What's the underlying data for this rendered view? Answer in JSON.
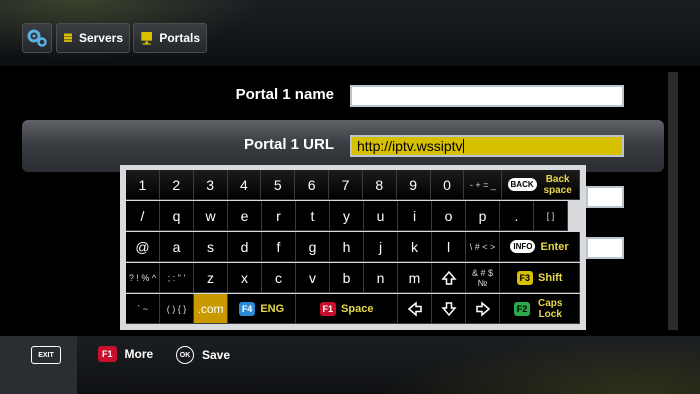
{
  "topbar": {
    "settings_icon": "gear-icon",
    "servers_label": "Servers",
    "portals_label": "Portals"
  },
  "form": {
    "portal_name_label": "Portal 1 name",
    "portal_name_value": "",
    "portal_url_label": "Portal 1 URL",
    "portal_url_value": "http://iptv.wssiptv"
  },
  "keyboard": {
    "row1": [
      "1",
      "2",
      "3",
      "4",
      "5",
      "6",
      "7",
      "8",
      "9",
      "0"
    ],
    "row1_symbols": "- + = _",
    "backspace_badge": "BACK",
    "backspace_label": "Back space",
    "row2": [
      "/",
      "q",
      "w",
      "e",
      "r",
      "t",
      "y",
      "u",
      "i",
      "o",
      "p"
    ],
    "row2_symbols": "[ ]",
    "row3": [
      "@",
      "a",
      "s",
      "d",
      "f",
      "g",
      "h",
      "j",
      "k",
      "l"
    ],
    "row3_symbols": "\\ # < >",
    "enter_badge": "INFO",
    "enter_label": "Enter",
    "row4_symbols_left": "? ! % ^",
    "row4_symbols_left2": "; : \" '",
    "row4": [
      "z",
      "x",
      "c",
      "v",
      "b",
      "n",
      "m"
    ],
    "row4_symbols_right": "& # $ №",
    "shift_badge": "F3",
    "shift_label": "Shift",
    "row5_left1": "` ~",
    "row5_left2": "( ) { }",
    "dotcom": ".com",
    "eng_badge": "F4",
    "eng_label": "ENG",
    "space_badge": "F1",
    "space_label": "Space",
    "caps_badge": "F2",
    "caps_label": "Caps Lock",
    "colors": {
      "yellow": "#d6c000",
      "blue": "#2a8bd8",
      "red": "#c8102e",
      "green": "#2ea84a",
      "com": "#c89a00"
    }
  },
  "bottombar": {
    "exit_label": "EXIT",
    "more_badge": "F1",
    "more_label": "More",
    "save_badge": "OK",
    "save_label": "Save"
  }
}
